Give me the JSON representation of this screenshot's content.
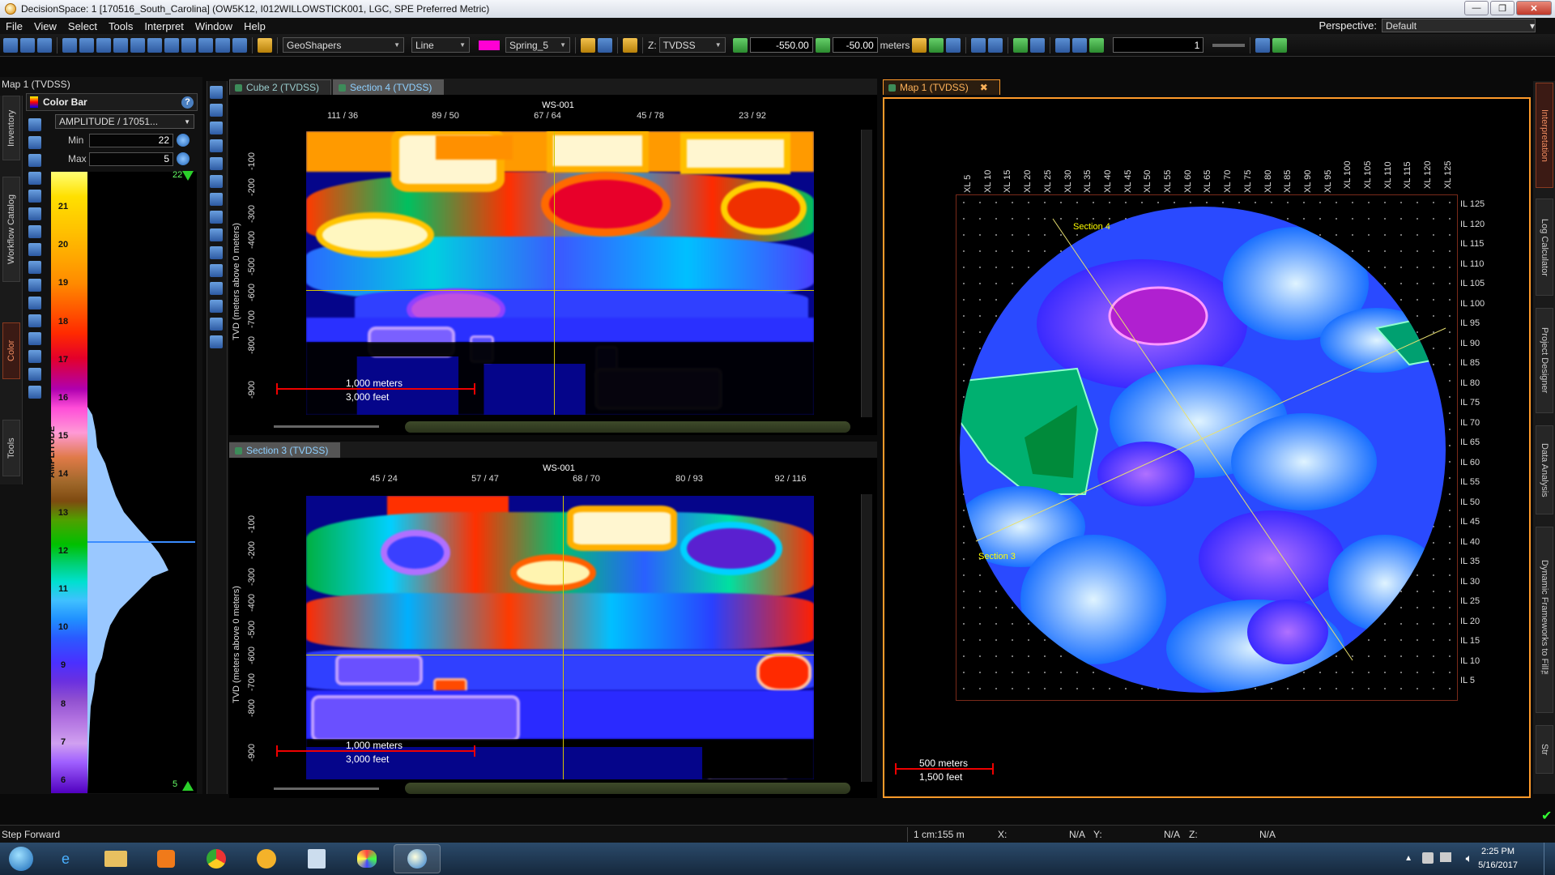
{
  "window": {
    "title": "DecisionSpace: 1 [170516_South_Carolina] (OW5K12, I012WILLOWSTICK001, LGC, SPE Preferred Metric)",
    "min": "—",
    "max": "❐",
    "close": "✕"
  },
  "menu": [
    "File",
    "View",
    "Select",
    "Tools",
    "Interpret",
    "Window",
    "Help"
  ],
  "perspective": {
    "label": "Perspective:",
    "value": "Default"
  },
  "toolbar": {
    "geoshapers": "GeoShapers",
    "line_style": "Line",
    "color_name": "Spring_5",
    "color_swatch": "#ff00d4",
    "z_label": "Z:",
    "z_domain": "TVDSS",
    "z_start": "-550.00",
    "z_step": "-50.00",
    "z_units": "meters",
    "page": "1"
  },
  "left_panel": {
    "map_title": "Map 1 (TVDSS)",
    "tabs": [
      "Inventory",
      "Workflow Catalog",
      "Color",
      "Tools"
    ],
    "colorbar": {
      "title": "Color Bar",
      "attribute": "AMPLITUDE / 17051...",
      "min_label": "Min",
      "min_value": "22",
      "max_label": "Max",
      "max_value": "5",
      "axis_title": "AMPLITUDE",
      "top_marker": "22",
      "bottom_marker": "5",
      "labels": [
        "21",
        "20",
        "19",
        "18",
        "17",
        "16",
        "15",
        "14",
        "13",
        "12",
        "11",
        "10",
        "9",
        "8",
        "7",
        "6"
      ]
    }
  },
  "section_top": {
    "tabs": [
      "Cube 2 (TVDSS)",
      "Section 4 (TVDSS)"
    ],
    "well": "WS-001",
    "x_ticks": [
      "111 / 36",
      "89 / 50",
      "67 / 64",
      "45 / 78",
      "23 / 92"
    ],
    "y_label": "TVD (meters above 0 meters)",
    "y_ticks": [
      "-100",
      "-200",
      "-300",
      "-400",
      "-500",
      "-600",
      "-700",
      "-800",
      "-900"
    ],
    "scale_m": "1,000 meters",
    "scale_ft": "3,000 feet"
  },
  "section_bottom": {
    "tabs": [
      "Section 3 (TVDSS)"
    ],
    "well": "WS-001",
    "x_ticks": [
      "45 / 24",
      "57 / 47",
      "68 / 70",
      "80 / 93",
      "92 / 116"
    ],
    "y_label": "TVD (meters above 0 meters)",
    "y_ticks": [
      "-100",
      "-200",
      "-300",
      "-400",
      "-500",
      "-600",
      "-700",
      "-800",
      "-900"
    ],
    "scale_m": "1,000 meters",
    "scale_ft": "3,000 feet"
  },
  "map_view": {
    "tab": "Map 1 (TVDSS)",
    "tab_close": "✖",
    "xl_labels": [
      "XL 5",
      "XL 10",
      "XL 15",
      "XL 20",
      "XL 25",
      "XL 30",
      "XL 35",
      "XL 40",
      "XL 45",
      "XL 50",
      "XL 55",
      "XL 60",
      "XL 65",
      "XL 70",
      "XL 75",
      "XL 80",
      "XL 85",
      "XL 90",
      "XL 95",
      "XL 100",
      "XL 105",
      "XL 110",
      "XL 115",
      "XL 120",
      "XL 125"
    ],
    "il_labels": [
      "IL 125",
      "IL 120",
      "IL 115",
      "IL 110",
      "IL 105",
      "IL 100",
      "IL 95",
      "IL 90",
      "IL 85",
      "IL 80",
      "IL 75",
      "IL 70",
      "IL 65",
      "IL 60",
      "IL 55",
      "IL 50",
      "IL 45",
      "IL 40",
      "IL 35",
      "IL 30",
      "IL 25",
      "IL 20",
      "IL 15",
      "IL 10",
      "IL 5"
    ],
    "section4_label": "Section 4",
    "section3_label": "Section 3",
    "scale_m": "500 meters",
    "scale_ft": "1,500 feet"
  },
  "right_tabs": [
    "Interpretation",
    "Log Calculator",
    "Project Designer",
    "Data Analysis",
    "Dynamic Frameworks to Fill™",
    "Str"
  ],
  "status": {
    "message": "Step Forward",
    "scale": "1 cm:155 m",
    "x_label": "X:",
    "x_value": "N/A",
    "y_label": "Y:",
    "y_value": "N/A",
    "z_label": "Z:",
    "z_value": "N/A"
  },
  "taskbar": {
    "apps": [
      "start-orb",
      "internet-explorer",
      "file-explorer",
      "media-player",
      "chrome",
      "app-yellow",
      "notepad",
      "paint",
      "decisionspace"
    ],
    "time": "2:25 PM",
    "date": "5/16/2017"
  }
}
